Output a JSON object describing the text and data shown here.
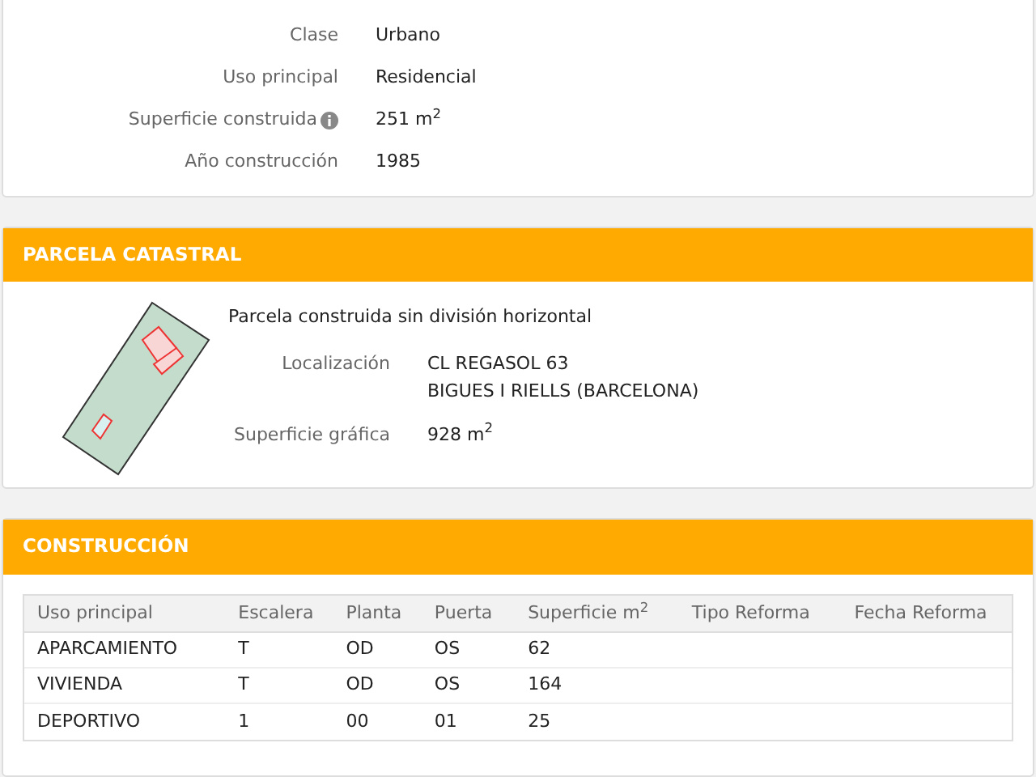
{
  "inmueble": {
    "fields": [
      {
        "label": "Clase",
        "value": "Urbano",
        "info": false
      },
      {
        "label": "Uso principal",
        "value": "Residencial",
        "info": false
      },
      {
        "label": "Superficie construida",
        "value": "251 m$^{2}$",
        "info": true
      },
      {
        "label": "Año construcción",
        "value": "1985",
        "info": false
      }
    ]
  },
  "parcela": {
    "title": "PARCELA CATASTRAL",
    "description": "Parcela construida sin división horizontal",
    "fields": [
      {
        "label": "Localización",
        "lines": [
          "CL REGASOL 63",
          "BIGUES I RIELLS (BARCELONA)"
        ]
      },
      {
        "label": "Superficie gráfica",
        "lines": [
          "928 m$^{2}$"
        ]
      }
    ]
  },
  "construccion": {
    "title": "CONSTRUCCIÓN",
    "table": {
      "columns": [
        "Uso principal",
        "Escalera",
        "Planta",
        "Puerta",
        "Superficie m$^{2}$",
        "Tipo Reforma",
        "Fecha Reforma"
      ],
      "rows": [
        [
          "APARCAMIENTO",
          "T",
          "OD",
          "OS",
          "62",
          "",
          ""
        ],
        [
          "VIVIENDA",
          "T",
          "OD",
          "OS",
          "164",
          "",
          ""
        ],
        [
          "DEPORTIVO",
          "1",
          "00",
          "01",
          "25",
          "",
          ""
        ]
      ]
    }
  }
}
